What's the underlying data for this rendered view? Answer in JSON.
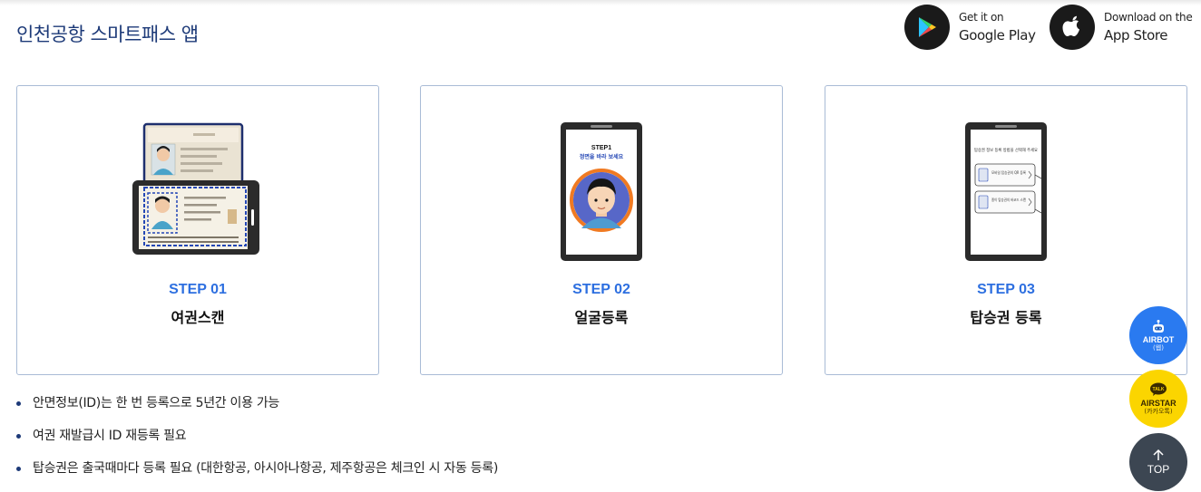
{
  "header": {
    "title": "인천공항 스마트패스 앱"
  },
  "stores": {
    "google": {
      "line1": "Get it on",
      "line2": "Google Play",
      "icon": "google-play-icon"
    },
    "apple": {
      "line1": "Download on the",
      "line2": "App Store",
      "icon": "apple-icon"
    }
  },
  "steps": [
    {
      "label": "STEP 01",
      "title": "여권스캔",
      "illustration": "passport-scan-illustration"
    },
    {
      "label": "STEP 02",
      "title": "얼굴등록",
      "illustration": "face-register-illustration",
      "screen_text": {
        "line1": "STEP1",
        "line2": "정면을 바라 보세요"
      }
    },
    {
      "label": "STEP 03",
      "title": "탑승권 등록",
      "illustration": "boarding-pass-illustration",
      "screen_text": {
        "heading": "탑승권 정보 등록 방법을 선택해 주세요",
        "opt1": "모바일 탑승권의 QR 등록",
        "opt2": "종이 탑승권의 바코드 스캔"
      }
    }
  ],
  "notes": [
    "안면정보(ID)는 한 번 등록으로 5년간 이용 가능",
    "여권 재발급시 ID 재등록 필요",
    "탑승권은 출국때마다 등록 필요 (대한항공, 아시아나항공, 제주항공은 체크인 시 자동 등록)"
  ],
  "floating": {
    "airbot": {
      "label": "AIRBOT",
      "sub": "(웹)"
    },
    "airstar": {
      "label": "AIRSTAR",
      "sub": "(카카오톡)",
      "badge": "TALK"
    },
    "top": {
      "label": "TOP"
    }
  },
  "colors": {
    "title": "#1d3a78",
    "step_accent": "#2d6fe0",
    "card_border": "#a9bbd6",
    "airbot": "#2a7af0",
    "airstar": "#fbd500",
    "top": "#3c4652"
  }
}
